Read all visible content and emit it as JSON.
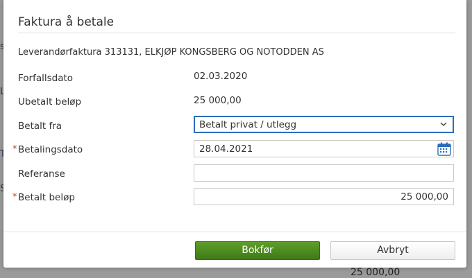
{
  "dialog": {
    "title": "Faktura å betale",
    "subtitle": "Leverandørfaktura 313131, ELKJØP KONGSBERG OG NOTODDEN AS"
  },
  "fields": {
    "due_date": {
      "label": "Forfallsdato",
      "value": "02.03.2020"
    },
    "unpaid_amount": {
      "label": "Ubetalt beløp",
      "value": "25 000,00"
    },
    "paid_from": {
      "label": "Betalt fra",
      "value": "Betalt privat / utlegg"
    },
    "payment_date": {
      "label": "Betalingsdato",
      "value": "28.04.2021",
      "required": "*"
    },
    "reference": {
      "label": "Referanse",
      "value": ""
    },
    "paid_amount": {
      "label": "Betalt beløp",
      "value": "25 000,00",
      "required": "*"
    }
  },
  "buttons": {
    "post": "Bokfør",
    "cancel": "Avbryt"
  },
  "background": {
    "bottom_value": "25 000,00"
  },
  "colors": {
    "primary_button": "#4a8a1f",
    "select_focus": "#2a6ebb",
    "required_mark": "#c0392b"
  }
}
